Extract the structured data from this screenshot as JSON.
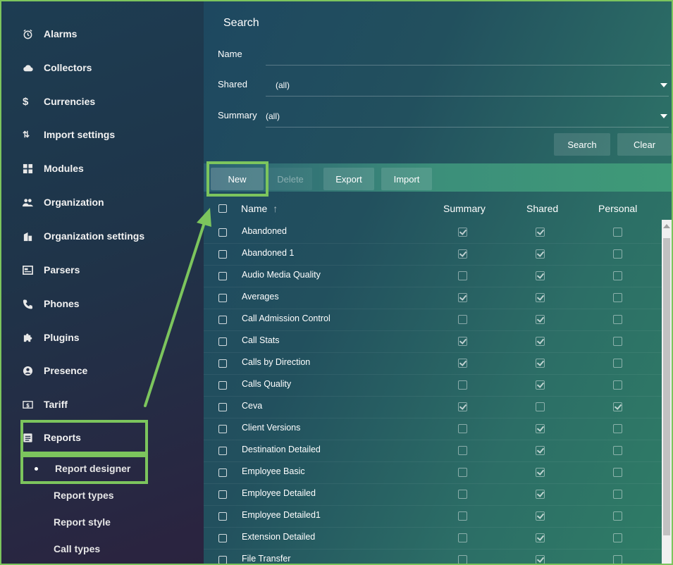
{
  "colors": {
    "highlight": "#7cc55d",
    "sidebar_bg": "#1f3449",
    "main_bg": "#2c6e66"
  },
  "sidebar": {
    "items": [
      {
        "label": "Alarms",
        "icon": "alarm-clock-icon"
      },
      {
        "label": "Collectors",
        "icon": "cloud-icon"
      },
      {
        "label": "Currencies",
        "icon": "dollar-icon"
      },
      {
        "label": "Import settings",
        "icon": "import-arrows-icon"
      },
      {
        "label": "Modules",
        "icon": "modules-icon"
      },
      {
        "label": "Organization",
        "icon": "users-icon"
      },
      {
        "label": "Organization settings",
        "icon": "building-icon"
      },
      {
        "label": "Parsers",
        "icon": "parser-icon"
      },
      {
        "label": "Phones",
        "icon": "phone-icon"
      },
      {
        "label": "Plugins",
        "icon": "puzzle-icon"
      },
      {
        "label": "Presence",
        "icon": "user-circle-icon"
      },
      {
        "label": "Tariff",
        "icon": "tariff-icon"
      },
      {
        "label": "Reports",
        "icon": "reports-icon"
      }
    ],
    "sub_items": [
      {
        "label": "Report designer",
        "active": true
      },
      {
        "label": "Report types",
        "active": false
      },
      {
        "label": "Report style",
        "active": false
      },
      {
        "label": "Call types",
        "active": false
      }
    ]
  },
  "search": {
    "title": "Search",
    "name_label": "Name",
    "name_value": "",
    "shared_label": "Shared",
    "shared_value": "(all)",
    "summary_label": "Summary",
    "summary_value": "(all)",
    "search_button": "Search",
    "clear_button": "Clear"
  },
  "toolbar": {
    "new_label": "New",
    "delete_label": "Delete",
    "export_label": "Export",
    "import_label": "Import"
  },
  "table": {
    "headers": {
      "name": "Name",
      "sort_indicator": "↑",
      "summary": "Summary",
      "shared": "Shared",
      "personal": "Personal"
    },
    "rows": [
      {
        "name": "Abandoned",
        "summary": true,
        "shared": true,
        "personal": false
      },
      {
        "name": "Abandoned 1",
        "summary": true,
        "shared": true,
        "personal": false
      },
      {
        "name": "Audio Media Quality",
        "summary": false,
        "shared": true,
        "personal": false
      },
      {
        "name": "Averages",
        "summary": true,
        "shared": true,
        "personal": false
      },
      {
        "name": "Call Admission Control",
        "summary": false,
        "shared": true,
        "personal": false
      },
      {
        "name": "Call Stats",
        "summary": true,
        "shared": true,
        "personal": false
      },
      {
        "name": "Calls by Direction",
        "summary": true,
        "shared": true,
        "personal": false
      },
      {
        "name": "Calls Quality",
        "summary": false,
        "shared": true,
        "personal": false
      },
      {
        "name": "Ceva",
        "summary": true,
        "shared": false,
        "personal": true
      },
      {
        "name": "Client Versions",
        "summary": false,
        "shared": true,
        "personal": false
      },
      {
        "name": "Destination Detailed",
        "summary": false,
        "shared": true,
        "personal": false
      },
      {
        "name": "Employee Basic",
        "summary": false,
        "shared": true,
        "personal": false
      },
      {
        "name": "Employee Detailed",
        "summary": false,
        "shared": true,
        "personal": false
      },
      {
        "name": "Employee Detailed1",
        "summary": false,
        "shared": true,
        "personal": false
      },
      {
        "name": "Extension Detailed",
        "summary": false,
        "shared": true,
        "personal": false
      },
      {
        "name": "File Transfer",
        "summary": false,
        "shared": true,
        "personal": false
      }
    ]
  }
}
